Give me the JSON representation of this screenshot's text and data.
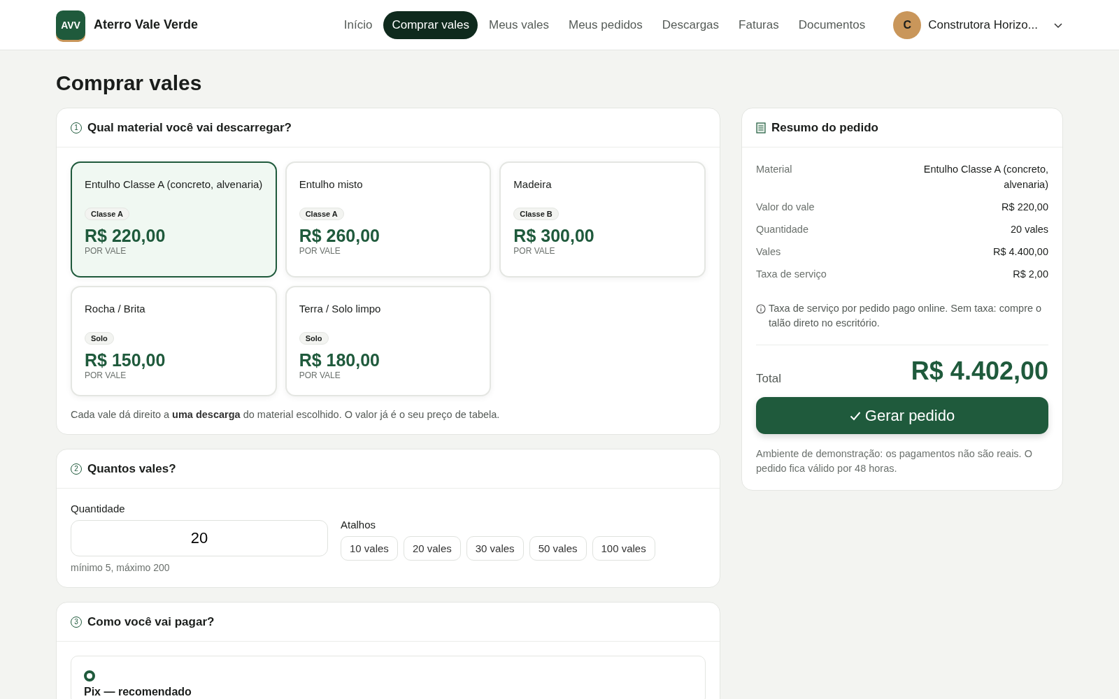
{
  "header": {
    "logo": "AVV",
    "brand": "Aterro Vale Verde",
    "nav": [
      {
        "label": "Início",
        "selected": false
      },
      {
        "label": "Comprar vales",
        "selected": true
      },
      {
        "label": "Meus vales",
        "selected": false
      },
      {
        "label": "Meus pedidos",
        "selected": false
      },
      {
        "label": "Descargas",
        "selected": false
      },
      {
        "label": "Faturas",
        "selected": false
      },
      {
        "label": "Documentos",
        "selected": false
      }
    ],
    "user": {
      "initial": "C",
      "name": "Construtora Horizo..."
    }
  },
  "page_title": "Comprar vales",
  "material_section": {
    "step": "1",
    "title": "Qual material você vai descarregar?",
    "materials": [
      {
        "name": "Entulho Classe A (concreto, alvenaria)",
        "tag": "Classe A",
        "price": "R$ 220,00",
        "unit": "POR VALE",
        "selected": true
      },
      {
        "name": "Entulho misto",
        "tag": "Classe A",
        "price": "R$ 260,00",
        "unit": "POR VALE",
        "selected": false
      },
      {
        "name": "Madeira",
        "tag": "Classe B",
        "price": "R$ 300,00",
        "unit": "POR VALE",
        "selected": false
      },
      {
        "name": "Rocha / Brita",
        "tag": "Solo",
        "price": "R$ 150,00",
        "unit": "POR VALE",
        "selected": false
      },
      {
        "name": "Terra / Solo limpo",
        "tag": "Solo",
        "price": "R$ 180,00",
        "unit": "POR VALE",
        "selected": false
      }
    ],
    "note": "Cada vale dá direito a **uma descarga** do material escolhido. O valor já é o seu preço de tabela."
  },
  "quantity_section": {
    "step": "2",
    "title": "Quantos vales?",
    "label": "Quantidade",
    "value": "20",
    "hint": "mínimo 5, máximo 200",
    "shortcuts_label": "Atalhos",
    "shortcuts": [
      "10 vales",
      "20 vales",
      "30 vales",
      "50 vales",
      "100 vales"
    ]
  },
  "payment_section": {
    "step": "3",
    "title": "Como você vai pagar?",
    "options": [
      {
        "label": "Pix — recomendado",
        "selected": true
      }
    ]
  },
  "summary": {
    "title": "Resumo do pedido",
    "rows": [
      {
        "label": "Material",
        "value": "Entulho Classe A (concreto, alvenaria)"
      },
      {
        "label": "Valor do vale",
        "value": "R$ 220,00"
      },
      {
        "label": "Quantidade",
        "value": "20 vales"
      },
      {
        "label": "Vales",
        "value": "R$ 4.400,00"
      },
      {
        "label": "Taxa de serviço",
        "value": "R$ 2,00"
      }
    ],
    "info": "Taxa de serviço por pedido pago online. Sem taxa: compre o talão direto no escritório.",
    "total_label": "Total",
    "total": "R$ 4.402,00",
    "button": "Gerar pedido",
    "footnote": "Ambiente de demonstração: os pagamentos não são reais. O pedido fica válido por 48 horas."
  }
}
